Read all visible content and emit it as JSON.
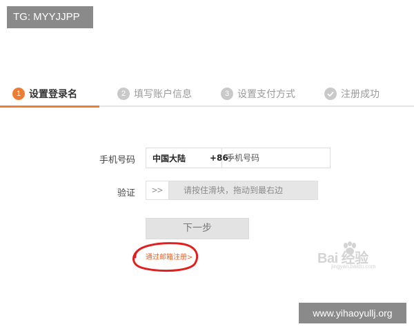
{
  "overlay": {
    "tg_label": "TG: MYYJJPP",
    "site_url": "www.yihaoyullj.org"
  },
  "steps": [
    {
      "number": "1",
      "label": "设置登录名",
      "state": "active"
    },
    {
      "number": "2",
      "label": "填写账户信息",
      "state": "pending"
    },
    {
      "number": "3",
      "label": "设置支付方式",
      "state": "pending"
    },
    {
      "number": "",
      "label": "注册成功",
      "state": "pending",
      "icon": "check-circle-icon"
    }
  ],
  "form": {
    "phone_label": "手机号码",
    "region_name": "中国大陆",
    "region_code": "+86",
    "phone_placeholder": "手机号码",
    "verify_label": "验证",
    "slider_handle": ">>",
    "slider_text": "请按住滑块，拖动到最右边",
    "next_button": "下一步",
    "email_register_link": "通过邮箱注册>"
  },
  "colors": {
    "accent": "#ee7d33",
    "link": "#e85e1e",
    "annotation": "#e02020"
  },
  "baidu_watermark": {
    "text": "Bai 经验",
    "subtext": "jingyan.baidu.com"
  }
}
